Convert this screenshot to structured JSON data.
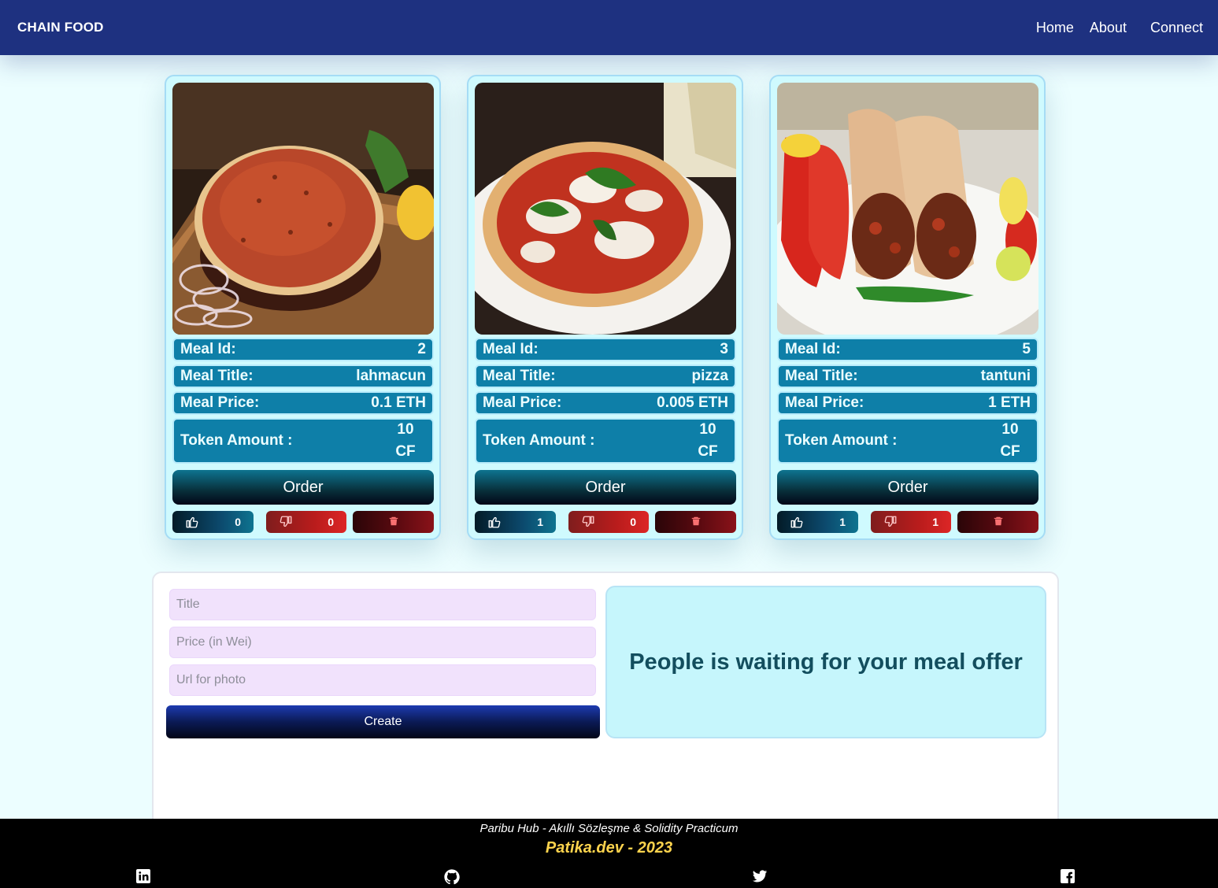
{
  "nav": {
    "brand": "CHAIN FOOD",
    "links": [
      "Home",
      "About",
      "Connect"
    ]
  },
  "labels": {
    "meal_id": "Meal Id:",
    "meal_title": "Meal Title:",
    "meal_price": "Meal Price:",
    "token_amount": "Token Amount :",
    "order": "Order"
  },
  "meals": [
    {
      "id": "2",
      "title": "lahmacun",
      "price": "0.1 ETH",
      "token_value": "10",
      "token_unit": "CF",
      "likes": "0",
      "dislikes": "0",
      "image_icon": "lahmacun-photo"
    },
    {
      "id": "3",
      "title": "pizza",
      "price": "0.005 ETH",
      "token_value": "10",
      "token_unit": "CF",
      "likes": "1",
      "dislikes": "0",
      "image_icon": "pizza-photo"
    },
    {
      "id": "5",
      "title": "tantuni",
      "price": "1 ETH",
      "token_value": "10",
      "token_unit": "CF",
      "likes": "1",
      "dislikes": "1",
      "image_icon": "tantuni-photo"
    }
  ],
  "form": {
    "title_placeholder": "Title",
    "price_placeholder": "Price (in Wei)",
    "url_placeholder": "Url for photo",
    "create_label": "Create",
    "message": "People is waiting for your meal offer"
  },
  "footer": {
    "line1": "Paribu Hub - Akıllı Sözleşme & Solidity Practicum",
    "line2": "Patika.dev - 2023",
    "icons": [
      "linkedin-icon",
      "github-icon",
      "twitter-icon",
      "facebook-icon"
    ]
  },
  "colors": {
    "nav_bg": "#1e3180",
    "card_bg": "#cffafe",
    "row_bg": "#0e7fa8",
    "accent_yellow": "#fcd34d",
    "info_text": "#134e5e"
  }
}
